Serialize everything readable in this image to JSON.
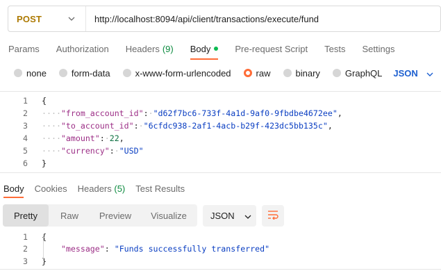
{
  "request": {
    "method": "POST",
    "url": "http://localhost:8094/api/client/transactions/execute/fund"
  },
  "request_tabs": [
    {
      "label": "Params"
    },
    {
      "label": "Authorization"
    },
    {
      "label": "Headers",
      "count": "(9)"
    },
    {
      "label": "Body"
    },
    {
      "label": "Pre-request Script"
    },
    {
      "label": "Tests"
    },
    {
      "label": "Settings"
    }
  ],
  "body_types": {
    "options": [
      "none",
      "form-data",
      "x-www-form-urlencoded",
      "raw",
      "binary",
      "GraphQL"
    ],
    "selected": "raw",
    "format": "JSON"
  },
  "request_body": {
    "line_numbers": [
      "1",
      "2",
      "3",
      "4",
      "5",
      "6"
    ],
    "open_brace": "{",
    "close_brace": "}",
    "fields": [
      {
        "key": "\"from_account_id\"",
        "value": "\"d62f7bc6-733f-4a1d-9af0-9fbdbe4672ee\"",
        "trail": ","
      },
      {
        "key": "\"to_account_id\"",
        "value": "\"6cfdc938-2af1-4acb-b29f-423dc5bb135c\"",
        "trail": ","
      },
      {
        "key": "\"amount\"",
        "value": "22",
        "trail": ","
      },
      {
        "key": "\"currency\"",
        "value": "\"USD\"",
        "trail": ""
      }
    ]
  },
  "response_tabs": [
    {
      "label": "Body"
    },
    {
      "label": "Cookies"
    },
    {
      "label": "Headers",
      "count": "(5)"
    },
    {
      "label": "Test Results"
    }
  ],
  "response_view": {
    "modes": [
      "Pretty",
      "Raw",
      "Preview",
      "Visualize"
    ],
    "active_mode": "Pretty",
    "format": "JSON"
  },
  "response_body": {
    "line_numbers": [
      "1",
      "2",
      "3"
    ],
    "open_brace": "{",
    "close_brace": "}",
    "key": "\"message\"",
    "value": "\"Funds successfully transferred\""
  },
  "colors": {
    "accent": "#ff6c37",
    "method": "#ad7a03",
    "json_key": "#9c2e86",
    "json_string": "#0a3ec2",
    "json_number": "#0a6e3f",
    "link_blue": "#1c5fd0"
  }
}
